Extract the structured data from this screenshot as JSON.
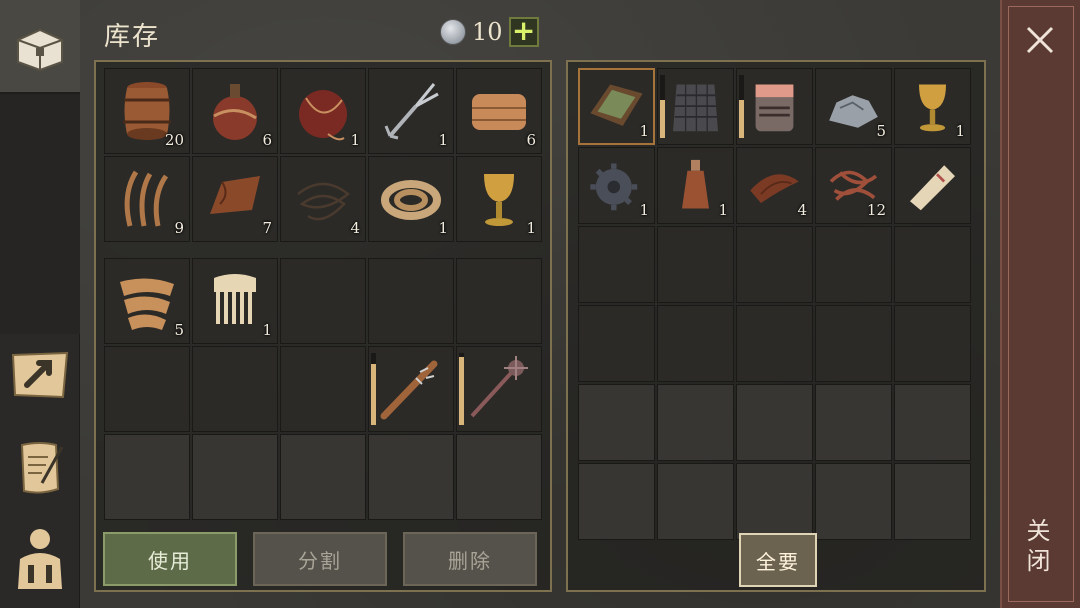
{
  "header": {
    "title": "库存",
    "currency_value": "10",
    "currency_icon": "silver-coin-icon",
    "add_label": "+"
  },
  "sidebar": {
    "tabs": [
      {
        "icon": "chest-icon",
        "active": true
      },
      {
        "icon": "map-arrow-icon",
        "active": false
      },
      {
        "icon": "scroll-quill-icon",
        "active": false
      },
      {
        "icon": "character-equipment-icon",
        "active": false
      }
    ]
  },
  "inventory": {
    "rows": [
      [
        {
          "icon": "barrel-icon",
          "qty": "20"
        },
        {
          "icon": "gourd-flask-icon",
          "qty": "6"
        },
        {
          "icon": "waterskin-icon",
          "qty": "1"
        },
        {
          "icon": "fork-tool-icon",
          "qty": "1"
        },
        {
          "icon": "folded-cloth-icon",
          "qty": "6"
        }
      ],
      [
        {
          "icon": "fiber-strands-icon",
          "qty": "9"
        },
        {
          "icon": "leather-scrap-icon",
          "qty": "7"
        },
        {
          "icon": "thread-coil-icon",
          "qty": "4"
        },
        {
          "icon": "rope-coil-icon",
          "qty": "1"
        },
        {
          "icon": "golden-goblet-icon",
          "qty": "1"
        }
      ]
    ],
    "bag_rows": [
      [
        {
          "icon": "silk-fabric-icon",
          "qty": "5"
        },
        {
          "icon": "bone-comb-icon",
          "qty": "1"
        },
        {},
        {},
        {}
      ],
      [
        {},
        {},
        {},
        {
          "icon": "spiked-club-icon",
          "qty": "",
          "durability": 0.85
        },
        {
          "icon": "mace-icon",
          "qty": "",
          "durability": 0.95
        }
      ],
      [
        {},
        {},
        {},
        {},
        {}
      ]
    ]
  },
  "loot": {
    "rows": [
      [
        {
          "icon": "wooden-tray-icon",
          "qty": "1",
          "selected": true
        },
        {
          "icon": "chainmail-armor-icon",
          "qty": "",
          "durability": 0.6
        },
        {
          "icon": "great-helm-icon",
          "qty": "",
          "durability": 0.6
        },
        {
          "icon": "iron-ore-icon",
          "qty": "5"
        },
        {
          "icon": "golden-goblet-icon",
          "qty": "1"
        }
      ],
      [
        {
          "icon": "gear-part-icon",
          "qty": "1"
        },
        {
          "icon": "clay-bottle-icon",
          "qty": "1"
        },
        {
          "icon": "leather-strap-icon",
          "qty": "4"
        },
        {
          "icon": "tangled-wire-icon",
          "qty": "12"
        },
        {
          "icon": "paper-roll-icon",
          "qty": ""
        }
      ],
      [
        {},
        {},
        {},
        {},
        {}
      ],
      [
        {},
        {},
        {},
        {},
        {}
      ],
      [
        {},
        {},
        {},
        {},
        {}
      ],
      [
        {},
        {},
        {},
        {},
        {}
      ]
    ]
  },
  "actions": {
    "use": "使用",
    "split": "分割",
    "delete": "删除",
    "take_all": "全要"
  },
  "close": {
    "label": "关闭",
    "icon": "close-icon"
  }
}
